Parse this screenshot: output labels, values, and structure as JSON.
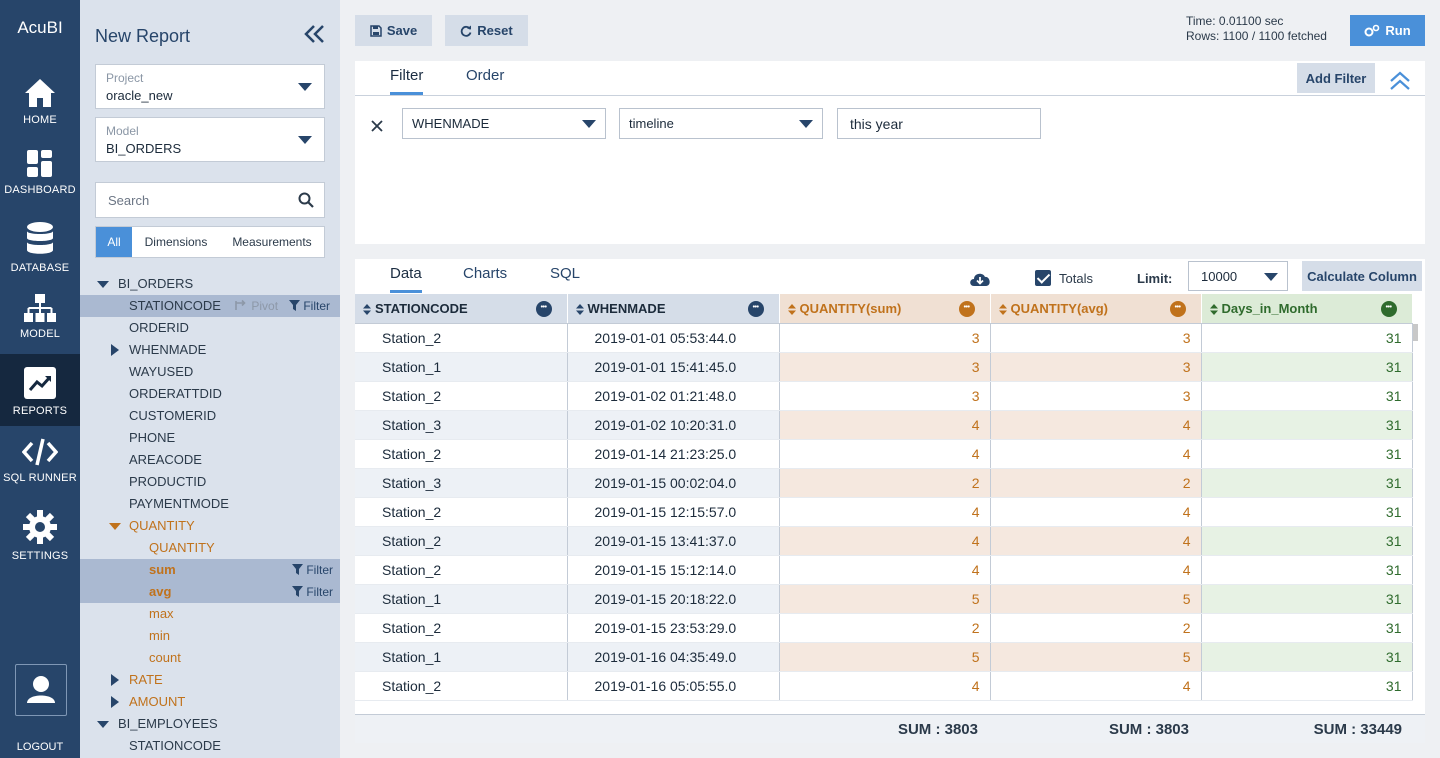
{
  "app": {
    "name": "AcuBI"
  },
  "nav": {
    "items": [
      {
        "label": "HOME",
        "icon": "home-icon"
      },
      {
        "label": "DASHBOARD",
        "icon": "dashboard-icon"
      },
      {
        "label": "DATABASE",
        "icon": "database-icon"
      },
      {
        "label": "MODEL",
        "icon": "model-icon"
      },
      {
        "label": "REPORTS",
        "icon": "reports-icon"
      },
      {
        "label": "SQL RUNNER",
        "icon": "code-icon"
      },
      {
        "label": "SETTINGS",
        "icon": "gear-icon"
      }
    ],
    "active": "REPORTS",
    "logout": "LOGOUT"
  },
  "sidebar": {
    "title": "New Report",
    "project": {
      "caption": "Project",
      "value": "oracle_new"
    },
    "model": {
      "caption": "Model",
      "value": "BI_ORDERS"
    },
    "search_placeholder": "Search",
    "filter_tabs": [
      "All",
      "Dimensions",
      "Measurements"
    ],
    "active_filter_tab": "All",
    "pivot_label": "Pivot",
    "filter_label": "Filter",
    "tree": [
      "BI_ORDERS",
      "STATIONCODE",
      "ORDERID",
      "WHENMADE",
      "WAYUSED",
      "ORDERATTDID",
      "CUSTOMERID",
      "PHONE",
      "AREACODE",
      "PRODUCTID",
      "PAYMENTMODE",
      "QUANTITY",
      "QUANTITY",
      "sum",
      "avg",
      "max",
      "min",
      "count",
      "RATE",
      "AMOUNT",
      "BI_EMPLOYEES",
      "STATIONCODE"
    ]
  },
  "toolbar": {
    "save": "Save",
    "reset": "Reset",
    "run": "Run",
    "time": "Time: 0.01100 sec",
    "rows": "Rows: 1100 / 1100 fetched"
  },
  "filter_panel": {
    "tabs": [
      "Filter",
      "Order"
    ],
    "active_tab": "Filter",
    "add_filter": "Add Filter",
    "filter": {
      "field": "WHENMADE",
      "operator": "timeline",
      "value": "this year"
    }
  },
  "data_panel": {
    "tabs": [
      "Data",
      "Charts",
      "SQL"
    ],
    "active_tab": "Data",
    "totals_label": "Totals",
    "totals_checked": true,
    "limit_label": "Limit:",
    "limit_value": "10000",
    "calculate_column": "Calculate Column",
    "columns": [
      "STATIONCODE",
      "WHENMADE",
      "QUANTITY(sum)",
      "QUANTITY(avg)",
      "Days_in_Month"
    ],
    "rows": [
      [
        "Station_2",
        "2019-01-01 05:53:44.0",
        "3",
        "3",
        "31"
      ],
      [
        "Station_1",
        "2019-01-01 15:41:45.0",
        "3",
        "3",
        "31"
      ],
      [
        "Station_2",
        "2019-01-02 01:21:48.0",
        "3",
        "3",
        "31"
      ],
      [
        "Station_3",
        "2019-01-02 10:20:31.0",
        "4",
        "4",
        "31"
      ],
      [
        "Station_2",
        "2019-01-14 21:23:25.0",
        "4",
        "4",
        "31"
      ],
      [
        "Station_3",
        "2019-01-15 00:02:04.0",
        "2",
        "2",
        "31"
      ],
      [
        "Station_2",
        "2019-01-15 12:15:57.0",
        "4",
        "4",
        "31"
      ],
      [
        "Station_2",
        "2019-01-15 13:41:37.0",
        "4",
        "4",
        "31"
      ],
      [
        "Station_2",
        "2019-01-15 15:12:14.0",
        "4",
        "4",
        "31"
      ],
      [
        "Station_1",
        "2019-01-15 20:18:22.0",
        "5",
        "5",
        "31"
      ],
      [
        "Station_2",
        "2019-01-15 23:53:29.0",
        "2",
        "2",
        "31"
      ],
      [
        "Station_1",
        "2019-01-16 04:35:49.0",
        "5",
        "5",
        "31"
      ],
      [
        "Station_2",
        "2019-01-16 05:05:55.0",
        "4",
        "4",
        "31"
      ]
    ],
    "sums": [
      "SUM : 3803",
      "SUM : 3803",
      "SUM : 33449"
    ]
  },
  "colors": {
    "nav_bg": "#27456a",
    "accent": "#4a90d9",
    "measure": "#c0721c",
    "calc": "#2f6b2d"
  }
}
